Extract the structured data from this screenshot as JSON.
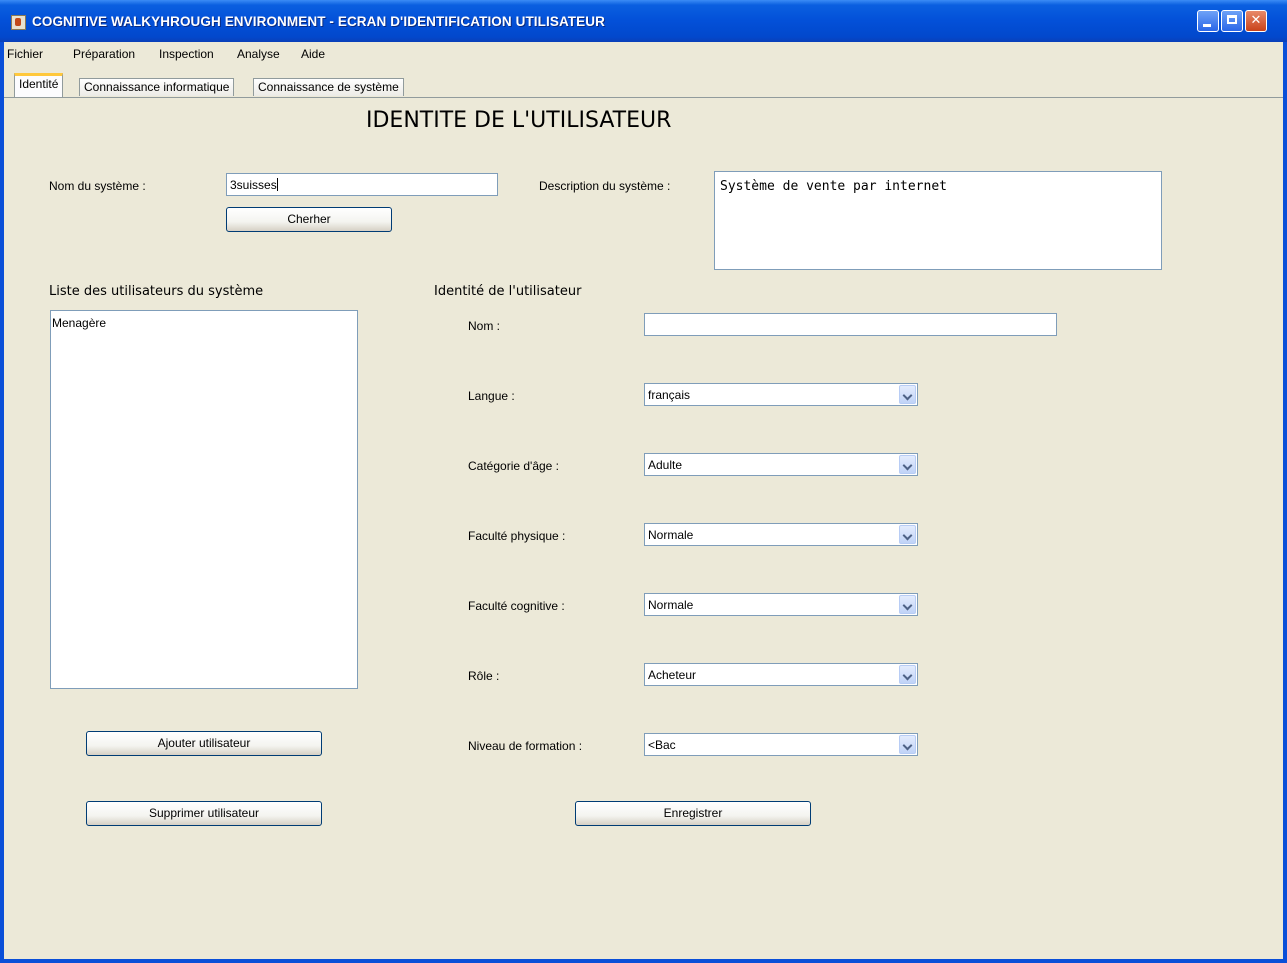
{
  "window": {
    "title": "COGNITIVE WALKYHROUGH ENVIRONMENT - ECRAN D'IDENTIFICATION UTILISATEUR",
    "icon": "java-cup-icon",
    "controls": [
      "minimize-icon",
      "maximize-icon",
      "close-icon"
    ]
  },
  "menubar": {
    "items": [
      "Fichier",
      "Préparation",
      "Inspection",
      "Analyse",
      "Aide"
    ]
  },
  "tabs": {
    "items": [
      "Identité",
      "Connaissance informatique",
      "Connaissance de système"
    ],
    "active": "Identité"
  },
  "page": {
    "heading": "IDENTITE DE L'UTILISATEUR"
  },
  "system": {
    "name_label": "Nom du système :",
    "name_value": "3suisses",
    "search_button": "Cherher",
    "description_label": "Description du système :",
    "description_value": "Système de vente par internet"
  },
  "users": {
    "section_title": "Liste des utilisateurs du système",
    "items": [
      "Menagère"
    ],
    "add_button": "Ajouter utilisateur",
    "delete_button": "Supprimer utilisateur"
  },
  "identity": {
    "section_title": "Identité de l'utilisateur",
    "nom_label": "Nom :",
    "nom_value": "",
    "langue_label": "Langue :",
    "langue_value": "français",
    "age_label": "Catégorie d'âge :",
    "age_value": "Adulte",
    "physique_label": "Faculté physique :",
    "physique_value": "Normale",
    "cognitive_label": "Faculté cognitive :",
    "cognitive_value": "Normale",
    "role_label": "Rôle :",
    "role_value": "Acheteur",
    "formation_label": "Niveau de formation :",
    "formation_value": "<Bac",
    "save_button": "Enregistrer"
  },
  "colors": {
    "titlebar": "#0350d8",
    "client_background": "#ece9d8",
    "field_border": "#7f9db9",
    "active_tab_accent": "#ffc83c"
  }
}
